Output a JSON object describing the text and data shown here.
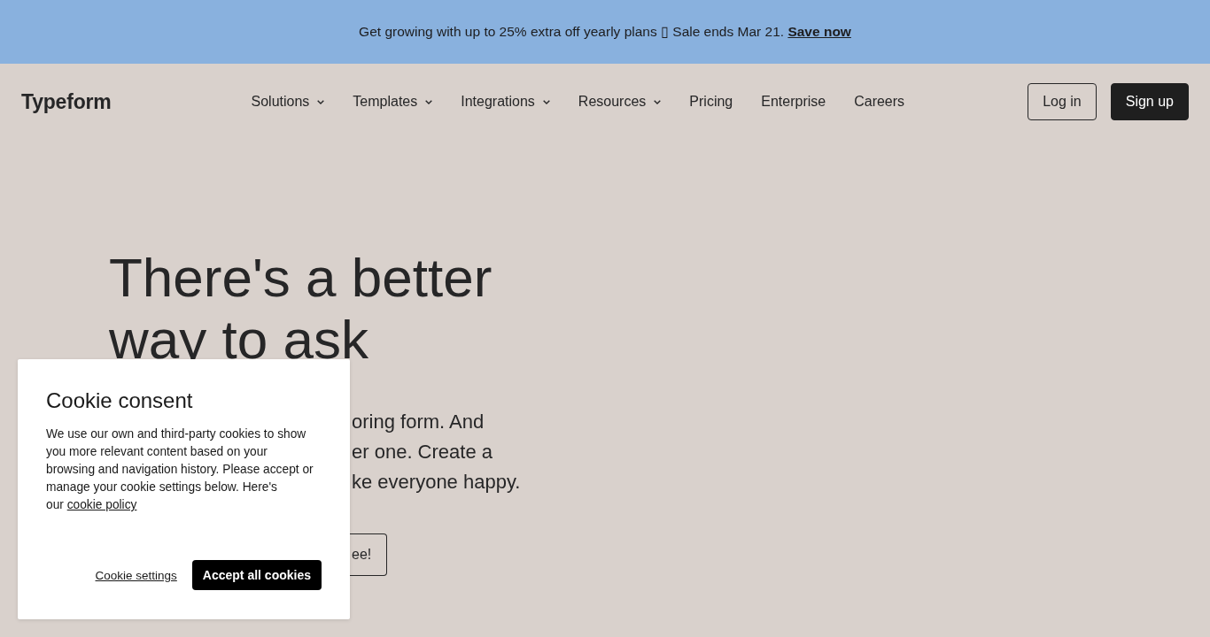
{
  "banner": {
    "text": "Get growing with up to 25% extra off yearly plans ▯ Sale ends Mar 21.",
    "link": "Save now"
  },
  "nav": {
    "logo": "Typeform",
    "items": [
      {
        "label": "Solutions",
        "kind": "dropdown"
      },
      {
        "label": "Templates",
        "kind": "dropdown"
      },
      {
        "label": "Integrations",
        "kind": "dropdown"
      },
      {
        "label": "Resources",
        "kind": "dropdown"
      },
      {
        "label": "Pricing",
        "kind": "link"
      },
      {
        "label": "Enterprise",
        "kind": "link"
      },
      {
        "label": "Careers",
        "kind": "link"
      }
    ],
    "login": "Log in",
    "signup": "Sign up"
  },
  "hero": {
    "heading": "There's a better way to ask",
    "text_fragments": [
      "oring form. And",
      "er one. Create a",
      "ke everyone happy."
    ],
    "button_fragment": "ee!"
  },
  "cookie_dialog": {
    "title": "Cookie consent",
    "body": "We use our own and third-party cookies to show you more relevant content based on your browsing and navigation history. Please accept or manage your cookie settings below. Here's our",
    "policy_link": "cookie policy",
    "settings_link": "Cookie settings",
    "accept_button": "Accept all cookies"
  }
}
